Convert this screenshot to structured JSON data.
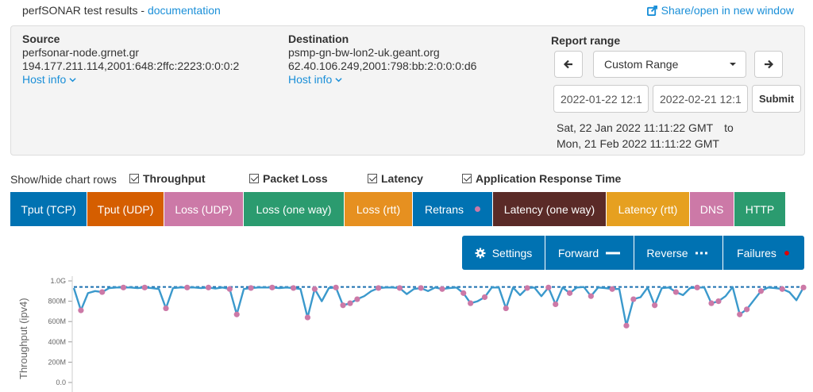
{
  "header": {
    "title": "perfSONAR test results - ",
    "doc_link": "documentation",
    "share_link": "Share/open in new window"
  },
  "source": {
    "label": "Source",
    "host": "perfsonar-node.grnet.gr",
    "addresses": "194.177.211.114,2001:648:2ffc:2223:0:0:0:2",
    "host_info": "Host info"
  },
  "destination": {
    "label": "Destination",
    "host": "psmp-gn-bw-lon2-uk.geant.org",
    "addresses": "62.40.106.249,2001:798:bb:2:0:0:0:d6",
    "host_info": "Host info"
  },
  "report_range": {
    "label": "Report range",
    "selected": "Custom Range",
    "start_input": "2022-01-22 12:1",
    "end_input": "2022-02-21 12:1",
    "submit": "Submit",
    "range_start": "Sat, 22 Jan 2022 11:11:22 GMT",
    "to": "to",
    "range_end": "Mon, 21 Feb 2022 11:11:22 GMT"
  },
  "show_hide": {
    "label": "Show/hide chart rows",
    "options": [
      "Throughput",
      "Packet Loss",
      "Latency",
      "Application Response Time"
    ]
  },
  "tabs": [
    {
      "label": "Tput (TCP)",
      "color": "#0072b2"
    },
    {
      "label": "Tput (UDP)",
      "color": "#d55e00"
    },
    {
      "label": "Loss (UDP)",
      "color": "#cc79a7"
    },
    {
      "label": "Loss (one way)",
      "color": "#2b9b6f"
    },
    {
      "label": "Loss (rtt)",
      "color": "#e69020"
    },
    {
      "label": "Retrans",
      "color": "#0072b2",
      "dot": "#cc79a7"
    },
    {
      "label": "Latency (one way)",
      "color": "#5a2a27"
    },
    {
      "label": "Latency (rtt)",
      "color": "#e6a020"
    },
    {
      "label": "DNS",
      "color": "#cc79a7"
    },
    {
      "label": "HTTP",
      "color": "#2b9b6f"
    }
  ],
  "controls": {
    "settings": "Settings",
    "forward": "Forward",
    "reverse": "Reverse",
    "failures": "Failures"
  },
  "chart_data": {
    "type": "line",
    "ylabel": "Throughput (ipv4)",
    "yticks": [
      "0.0",
      "200M",
      "400M",
      "600M",
      "800M",
      "1.0G"
    ],
    "ylim": [
      0,
      1000
    ],
    "average_line": 940,
    "series": [
      {
        "values": [
          930,
          710,
          880,
          900,
          890,
          930,
          935,
          935,
          935,
          930,
          935,
          930,
          920,
          730,
          930,
          935,
          935,
          935,
          930,
          935,
          925,
          935,
          920,
          670,
          920,
          930,
          935,
          935,
          935,
          930,
          935,
          930,
          920,
          640,
          920,
          800,
          930,
          935,
          760,
          780,
          820,
          850,
          900,
          930,
          935,
          935,
          930,
          870,
          920,
          930,
          900,
          935,
          920,
          930,
          935,
          880,
          780,
          800,
          840,
          935,
          935,
          730,
          935,
          860,
          930,
          935,
          850,
          935,
          770,
          935,
          880,
          935,
          940,
          850,
          935,
          930,
          920,
          920,
          560,
          820,
          840,
          935,
          760,
          930,
          935,
          890,
          860,
          930,
          935,
          935,
          780,
          800,
          850,
          940,
          670,
          720,
          810,
          900,
          935,
          930,
          920,
          890,
          810,
          935
        ]
      }
    ]
  },
  "colors": {
    "line": "#3b99cc",
    "marker": "#cc79a7",
    "avg": "#1a6fb0",
    "failures_dot": "#e00000"
  }
}
